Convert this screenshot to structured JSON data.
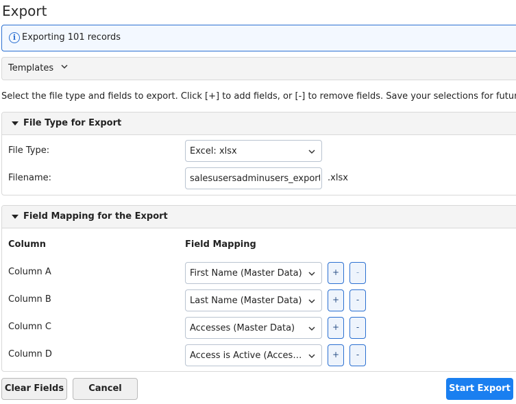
{
  "page": {
    "title": "Export"
  },
  "info": {
    "icon": "info-icon",
    "text": "Exporting 101 records"
  },
  "templates": {
    "label": "Templates",
    "icon": "chevron-down-icon"
  },
  "description": "Select the file type and fields to export. Click [+] to add fields, or [-] to remove fields. Save your selections for future use",
  "file_type_section": {
    "title": "File Type for Export",
    "file_type_label": "File Type:",
    "file_type_value": "Excel: xlsx",
    "filename_label": "Filename:",
    "filename_value": "salesusersadminusers_export",
    "filename_suffix": ".xlsx"
  },
  "mapping_section": {
    "title": "Field Mapping for the Export",
    "column_header": "Column",
    "mapping_header": "Field Mapping",
    "add_label": "+",
    "remove_label": "-",
    "rows": [
      {
        "column": "Column A",
        "mapping": "First Name (Master Data)"
      },
      {
        "column": "Column B",
        "mapping": "Last Name (Master Data)"
      },
      {
        "column": "Column C",
        "mapping": "Accesses (Master Data)"
      },
      {
        "column": "Column D",
        "mapping": "Access is Active (Access Data)"
      }
    ]
  },
  "footer": {
    "clear_label": "Clear Fields",
    "cancel_label": "Cancel",
    "start_label": "Start Export"
  },
  "colors": {
    "accent": "#1a7ff0",
    "info_border": "#2a6fd1"
  }
}
